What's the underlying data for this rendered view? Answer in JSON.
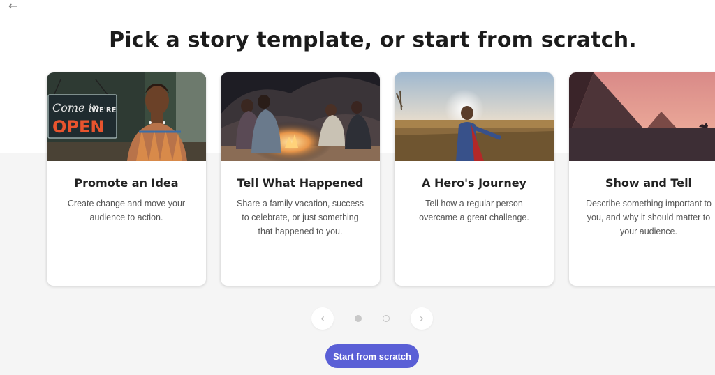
{
  "nav": {
    "back_icon": "arrow-left-icon",
    "back_glyph": "←"
  },
  "page": {
    "headline": "Pick a story template, or start from scratch."
  },
  "templates": [
    {
      "title": "Promote an Idea",
      "description": "Create change and move your audience to action.",
      "sign_line1": "Come in",
      "sign_line2": "WE'RE",
      "sign_line3": "OPEN"
    },
    {
      "title": "Tell What Happened",
      "description": "Share a family vacation, success to celebrate, or just something that happened to you."
    },
    {
      "title": "A Hero's Journey",
      "description": "Tell how a regular person overcame a great challenge."
    },
    {
      "title": "Show and Tell",
      "description": "Describe something important to you, and why it should matter to your audience."
    }
  ],
  "pager": {
    "prev_icon": "chevron-left-icon",
    "prev_glyph": "‹",
    "next_icon": "chevron-right-icon",
    "next_glyph": "›",
    "current_page": 1,
    "total_pages": 2
  },
  "cta": {
    "label": "Start from scratch"
  },
  "colors": {
    "accent": "#5a5fd6",
    "band": "#f5f5f5"
  }
}
